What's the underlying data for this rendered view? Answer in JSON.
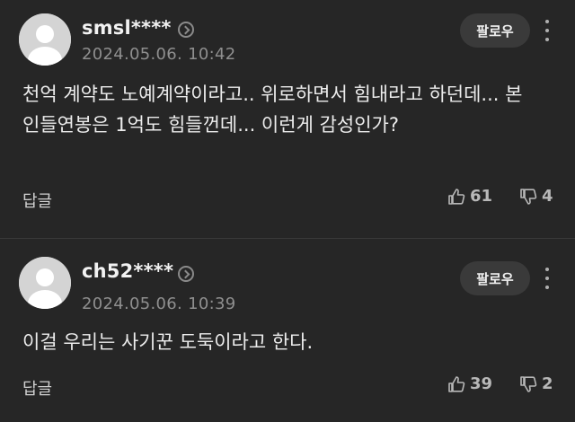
{
  "comments": [
    {
      "username": "smsl****",
      "date": "2024.05.06. 10:42",
      "follow_label": "팔로우",
      "text": "천억 계약도 노예계약이라고.. 위로하면서 힘내라고 하던데... 본인들연봉은 1억도 힘들껀데... 이런게 감성인가?",
      "reply_label": "답글",
      "likes": "61",
      "dislikes": "4"
    },
    {
      "username": "ch52****",
      "date": "2024.05.06. 10:39",
      "follow_label": "팔로우",
      "text": "이걸 우리는 사기꾼 도둑이라고 한다.",
      "reply_label": "답글",
      "likes": "39",
      "dislikes": "2"
    }
  ],
  "colors": {
    "background": "#262626",
    "button": "#3a3a3a"
  },
  "icons": [
    "avatar-placeholder-icon",
    "chevron-right-circle-icon",
    "more-vertical-icon",
    "thumbs-up-icon",
    "thumbs-down-icon"
  ]
}
